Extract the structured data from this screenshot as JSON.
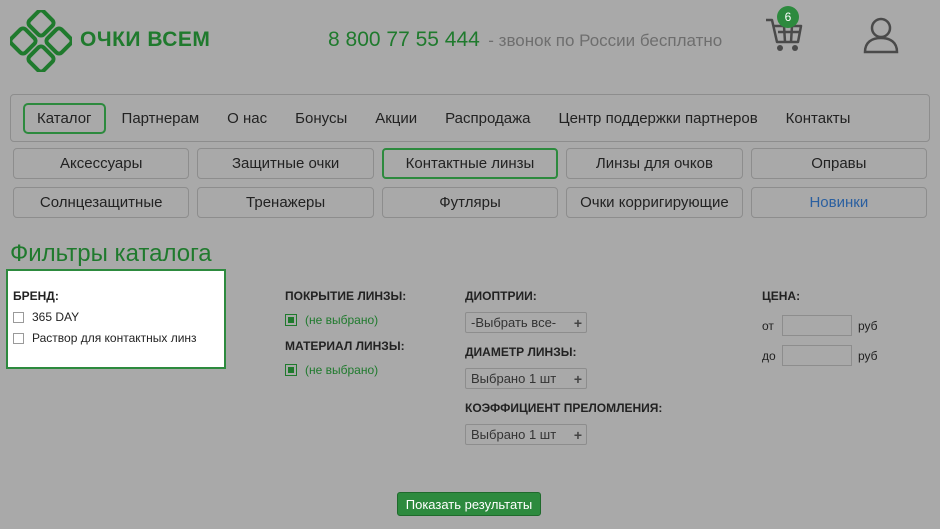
{
  "header": {
    "logo_text": "ОЧКИ ВСЕМ",
    "phone": "8 800 77 55 444",
    "phone_note": "- звонок по России бесплатно",
    "cart_count": "6"
  },
  "main_menu": [
    {
      "label": "Каталог",
      "active": true
    },
    {
      "label": "Партнерам"
    },
    {
      "label": "О нас"
    },
    {
      "label": "Бонусы"
    },
    {
      "label": "Акции"
    },
    {
      "label": "Распродажа"
    },
    {
      "label": "Центр поддержки партнеров"
    },
    {
      "label": "Контакты"
    }
  ],
  "categories": {
    "row1": [
      "Аксессуары",
      "Защитные очки",
      "Контактные линзы",
      "Линзы для очков",
      "Оправы"
    ],
    "row2": [
      "Солнцезащитные",
      "Тренажеры",
      "Футляры",
      "Очки корригирующие",
      "Новинки"
    ]
  },
  "filters": {
    "title": "Фильтры каталога",
    "brand": {
      "label": "БРЕНД:",
      "items": [
        "365 DAY",
        "Раствор для контактных линз"
      ]
    },
    "coating": {
      "label": "ПОКРЫТИЕ ЛИНЗЫ:",
      "value": "(не выбрано)"
    },
    "material": {
      "label": "МАТЕРИАЛ ЛИНЗЫ:",
      "value": "(не выбрано)"
    },
    "diopters": {
      "label": "ДИОПТРИИ:",
      "value": "-Выбрать все-"
    },
    "diameter": {
      "label": "ДИАМЕТР ЛИНЗЫ:",
      "value": "Выбрано 1 шт"
    },
    "refraction": {
      "label": "КОЭФФИЦИЕНТ ПРЕЛОМЛЕНИЯ:",
      "value": "Выбрано 1 шт"
    },
    "price": {
      "label": "ЦЕНА:",
      "from_label": "от",
      "to_label": "до",
      "currency": "руб"
    },
    "submit_label": "Показать результаты"
  },
  "colors": {
    "accent": "#2d8a3e",
    "background": "#a9a9a9",
    "link_blue": "#2a5fa0"
  }
}
